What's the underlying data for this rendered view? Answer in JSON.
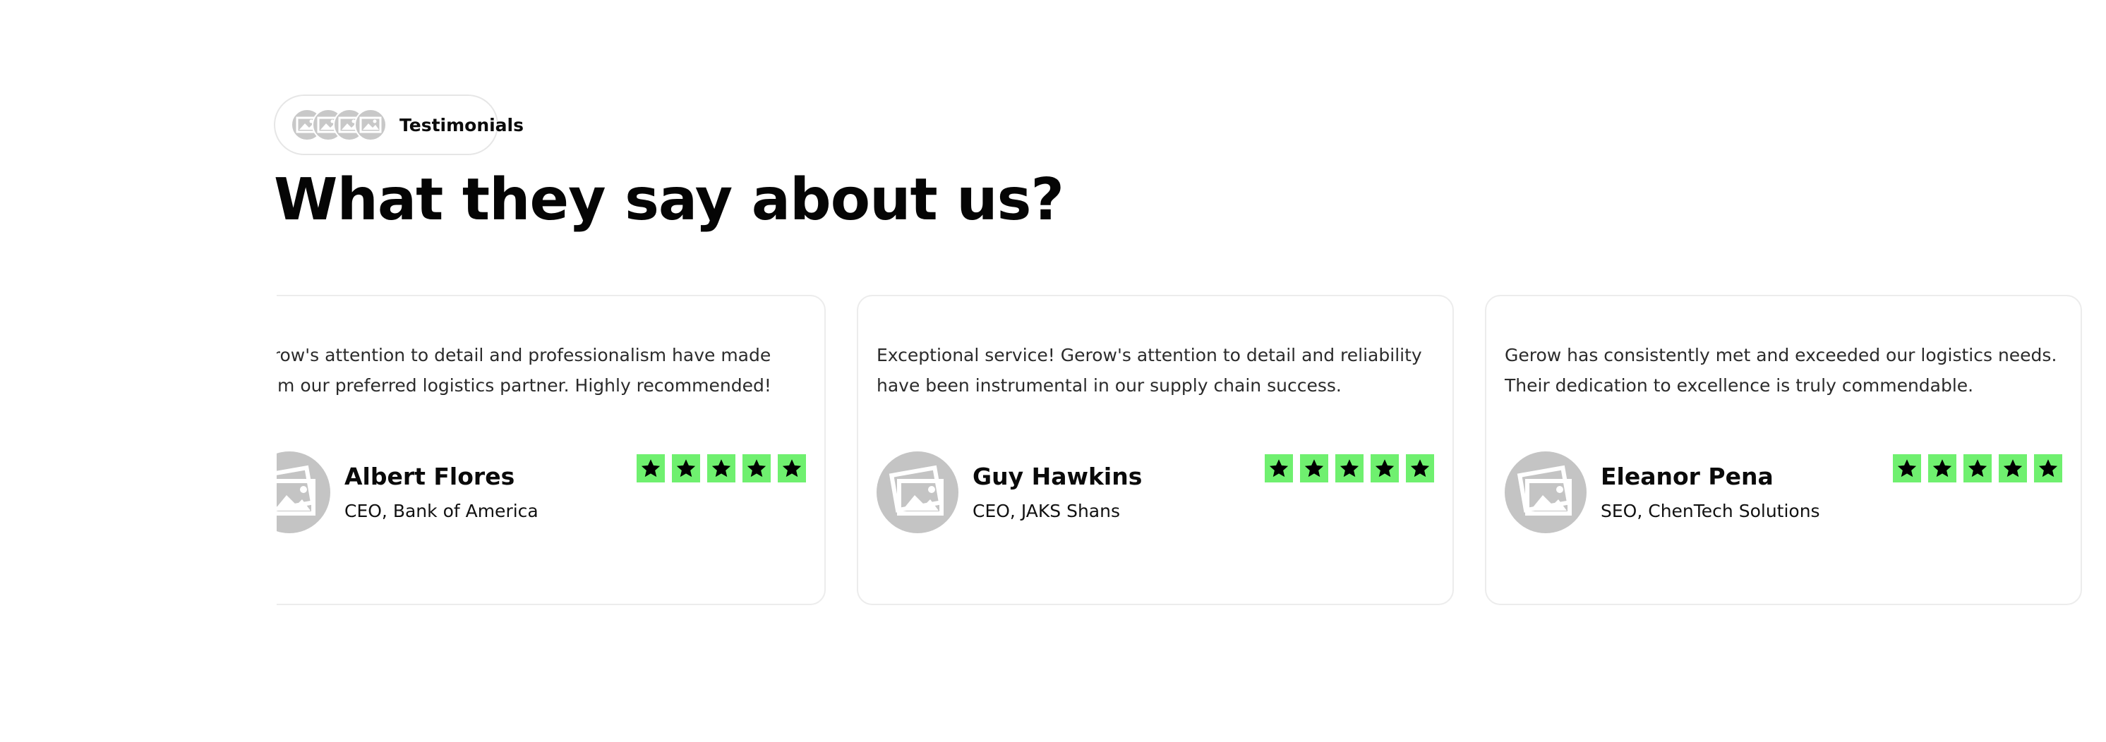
{
  "badge": {
    "label": "Testimonials",
    "avatar_count": 4,
    "avatar_icon": "image-placeholder-icon"
  },
  "heading": "What they say about us?",
  "colors": {
    "star_bg": "#6ff06f",
    "star_fg": "#000000",
    "avatar_placeholder": "#c4c4c4",
    "card_border": "#ececec"
  },
  "testimonials": [
    {
      "text": "Gerow's attention to detail and professionalism have made them our preferred logistics partner. Highly recommended!",
      "name": "Albert Flores",
      "role": "CEO, Bank of America",
      "rating": 5,
      "photo_icon": "image-placeholder-icon"
    },
    {
      "text": "Exceptional service! Gerow's attention to detail and reliability have been instrumental in our supply chain success.",
      "name": "Guy Hawkins",
      "role": "CEO, JAKS Shans",
      "rating": 5,
      "photo_icon": "image-placeholder-icon"
    },
    {
      "text": "Gerow has consistently met and exceeded our logistics needs. Their dedication to excellence is truly commendable.",
      "name": "Eleanor Pena",
      "role": "SEO, ChenTech Solutions",
      "rating": 5,
      "photo_icon": "image-placeholder-icon"
    }
  ]
}
